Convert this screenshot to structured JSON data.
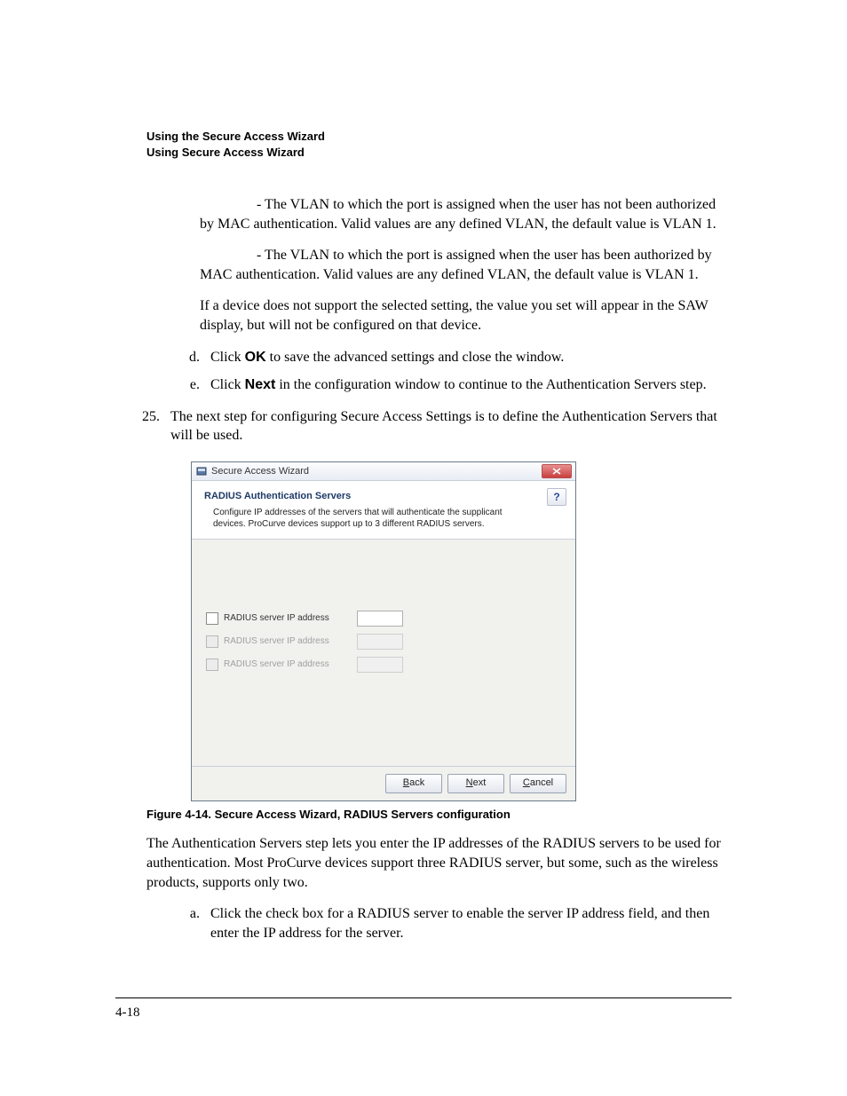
{
  "header": {
    "line1": "Using the Secure Access Wizard",
    "line2": "Using Secure Access Wizard"
  },
  "paragraphs": {
    "vlan_unauth": " - The VLAN to which the port is assigned when the user has not been authorized by MAC authentication. Valid values are any defined VLAN, the default value is VLAN 1.",
    "vlan_auth": " - The VLAN to which the port is assigned when the user has been authorized by MAC authentication. Valid values are any defined VLAN, the default value is VLAN 1.",
    "unsupported": "If a device does not support the selected setting, the value you set will appear in the SAW display, but will not be configured on that device.",
    "auth_servers_intro": "The Authentication Servers step lets you enter the IP addresses of the RADIUS servers to be used for authentication. Most ProCurve devices support three RADIUS server, but some, such as the wireless products, supports only two."
  },
  "steps": {
    "d": {
      "marker": "d.",
      "pre": "Click ",
      "bold": "OK",
      "post": " to save the advanced settings and close the window."
    },
    "e": {
      "marker": "e.",
      "pre": "Click ",
      "bold": "Next",
      "post": " in the configuration window to continue to the Authentication Servers step."
    },
    "n25": {
      "marker": "25.",
      "text": "The next step for configuring Secure Access Settings is to define the Authentication Servers that will be used."
    },
    "a": {
      "marker": "a.",
      "text": "Click the check box for a RADIUS server to enable the server IP address field, and then enter the IP address for the server."
    }
  },
  "figure": {
    "caption": "Figure 4-14. Secure Access Wizard, RADIUS Servers configuration"
  },
  "wizard": {
    "title": "Secure Access Wizard",
    "panel_title": "RADIUS Authentication Servers",
    "panel_desc": "Configure IP addresses of the servers that will authenticate the supplicant devices. ProCurve devices support up to 3 different RADIUS servers.",
    "help_label": "?",
    "rows": [
      {
        "label": "RADIUS server IP address",
        "enabled": true
      },
      {
        "label": "RADIUS server IP address",
        "enabled": false
      },
      {
        "label": "RADIUS server IP address",
        "enabled": false
      }
    ],
    "buttons": {
      "back": {
        "u": "B",
        "rest": "ack"
      },
      "next": {
        "u": "N",
        "rest": "ext"
      },
      "cancel": {
        "u": "C",
        "rest": "ancel"
      }
    }
  },
  "page_number": "4-18"
}
